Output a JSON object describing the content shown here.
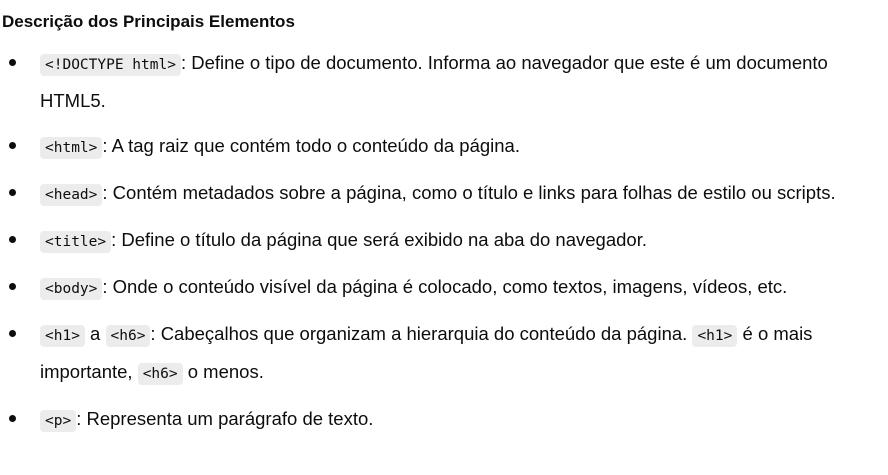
{
  "heading": "Descrição dos Principais Elementos",
  "items": [
    {
      "parts": [
        {
          "code": "<!DOCTYPE html>"
        },
        {
          "text": ": Define o tipo de documento. Informa ao navegador que este é um documento HTML5."
        }
      ]
    },
    {
      "parts": [
        {
          "code": "<html>"
        },
        {
          "text": ": A tag raiz que contém todo o conteúdo da página."
        }
      ]
    },
    {
      "parts": [
        {
          "code": "<head>"
        },
        {
          "text": ": Contém metadados sobre a página, como o título e links para folhas de estilo ou scripts."
        }
      ]
    },
    {
      "parts": [
        {
          "code": "<title>"
        },
        {
          "text": ": Define o título da página que será exibido na aba do navegador."
        }
      ]
    },
    {
      "parts": [
        {
          "code": "<body>"
        },
        {
          "text": ": Onde o conteúdo visível da página é colocado, como textos, imagens, vídeos, etc."
        }
      ]
    },
    {
      "parts": [
        {
          "code": "<h1>"
        },
        {
          "text": " a "
        },
        {
          "code": "<h6>"
        },
        {
          "text": ": Cabeçalhos que organizam a hierarquia do conteúdo da página. "
        },
        {
          "code": "<h1>"
        },
        {
          "text": " é o mais importante, "
        },
        {
          "code": "<h6>"
        },
        {
          "text": " o menos."
        }
      ]
    },
    {
      "parts": [
        {
          "code": "<p>"
        },
        {
          "text": ": Representa um parágrafo de texto."
        }
      ]
    }
  ]
}
